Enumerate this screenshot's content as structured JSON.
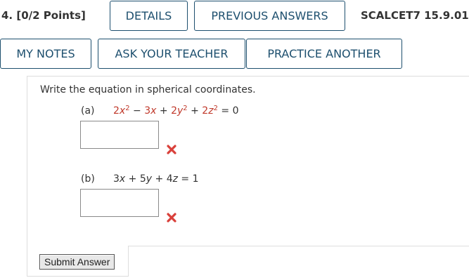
{
  "header": {
    "question_label": "4.  [0/2 Points]",
    "details_label": "DETAILS",
    "previous_answers_label": "PREVIOUS ANSWERS",
    "reference": "SCALCET7 15.9.01"
  },
  "actions": {
    "my_notes_label": "MY NOTES",
    "ask_teacher_label": "ASK YOUR TEACHER",
    "practice_another_label": "PRACTICE ANOTHER"
  },
  "question": {
    "instructions": "Write the equation in spherical coordinates.",
    "parts": [
      {
        "label": "(a)",
        "answer_value": "",
        "status": "incorrect"
      },
      {
        "label": "(b)",
        "answer_value": "",
        "status": "incorrect"
      }
    ]
  },
  "submit": {
    "label": "Submit Answer"
  },
  "colors": {
    "button_border": "#1d4f6e",
    "incorrect": "#d9403a",
    "equation_highlight": "#c0392b"
  },
  "icons": {
    "incorrect": "x-mark-icon"
  }
}
